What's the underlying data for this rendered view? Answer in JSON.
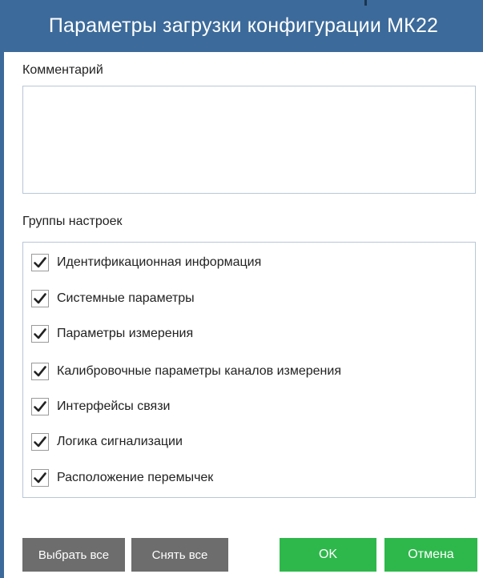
{
  "dialog": {
    "title": "Параметры загрузки конфигурации МК22",
    "comment_label": "Комментарий",
    "comment_value": "",
    "groups_label": "Группы настроек",
    "groups": [
      {
        "label": "Идентификационная информация",
        "checked": true
      },
      {
        "label": "Системные параметры",
        "checked": true
      },
      {
        "label": "Параметры измерения",
        "checked": true
      },
      {
        "label": "Калибровочные параметры каналов измерения",
        "checked": true
      },
      {
        "label": "Интерфейсы связи",
        "checked": true
      },
      {
        "label": "Логика сигнализации",
        "checked": true
      },
      {
        "label": "Расположение перемычек",
        "checked": true
      }
    ]
  },
  "buttons": {
    "select_all": "Выбрать все",
    "deselect_all": "Снять все",
    "ok": "OK",
    "cancel": "Отмена"
  },
  "colors": {
    "title_bar": "#3c6a9a",
    "button_gray": "#6d6d6d",
    "button_green": "#2eb84b"
  }
}
